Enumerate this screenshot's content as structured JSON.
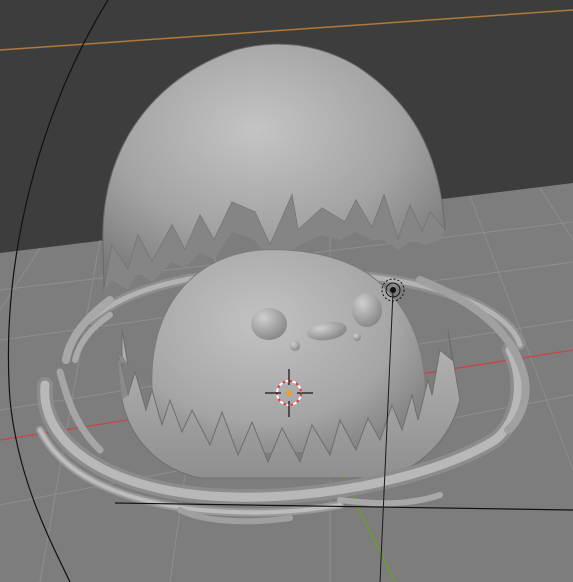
{
  "viewport": {
    "mode": "3D Viewport",
    "shading": "solid"
  },
  "scene": {
    "objects": [
      {
        "name": "egg-top-shell",
        "kind": "mesh"
      },
      {
        "name": "chick-body",
        "kind": "mesh"
      },
      {
        "name": "egg-bottom-shell",
        "kind": "mesh"
      },
      {
        "name": "twig-nest-ring",
        "kind": "mesh"
      }
    ],
    "helpers": [
      "3d-cursor",
      "light-icon",
      "grid-floor",
      "x-axis-line",
      "y-axis-line",
      "camera-frame-line"
    ]
  },
  "colors": {
    "wall": "#3d3d3d",
    "floor": "#7d7d7d",
    "grid": "#8c8c8c",
    "mesh": "#a9a9a9",
    "x_axis": "#c84646",
    "y_axis": "#6b9e2d",
    "horizon_line": "#b07a3a"
  }
}
